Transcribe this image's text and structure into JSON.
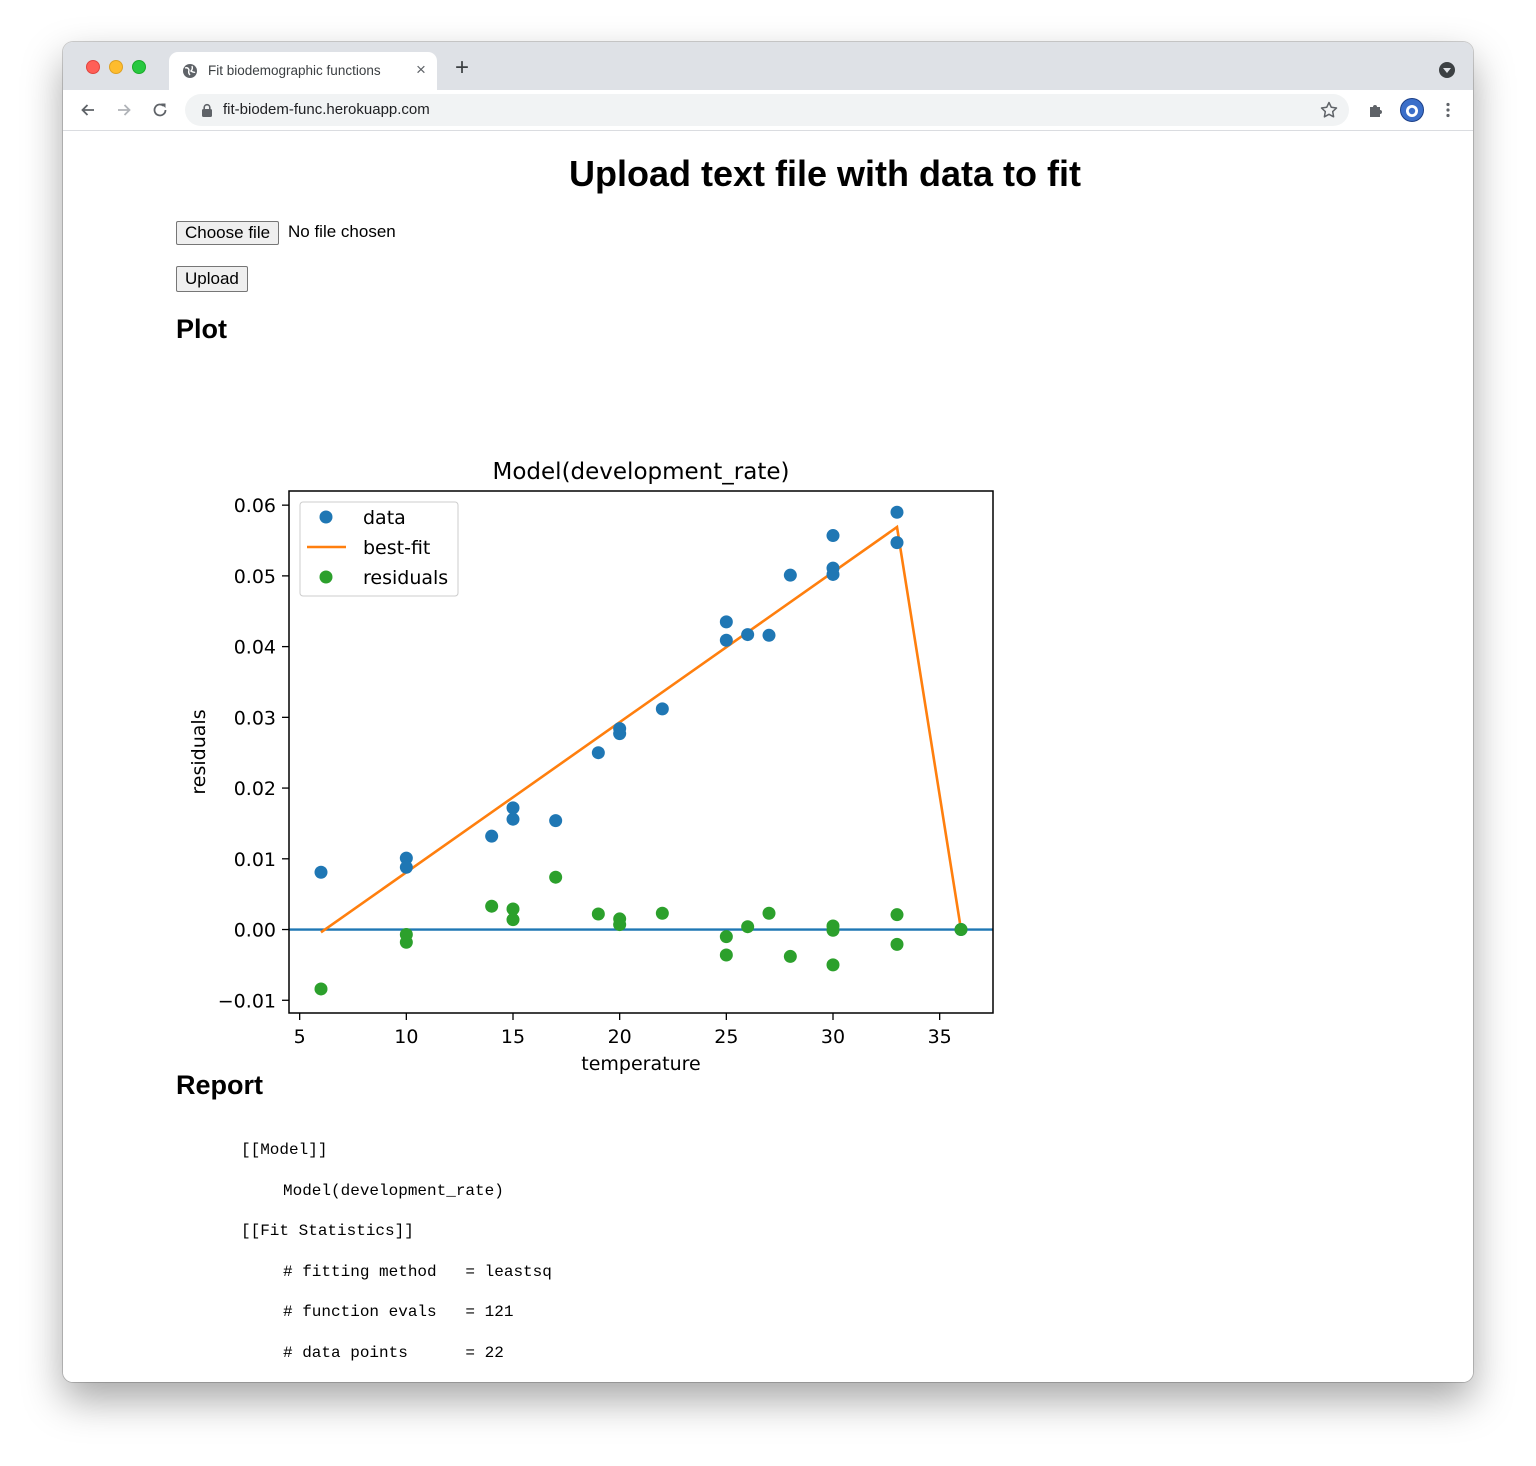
{
  "browser": {
    "tab_title": "Fit biodemographic functions",
    "url": "fit-biodem-func.herokuapp.com",
    "new_tab_label": "+",
    "close_tab_label": "×"
  },
  "page": {
    "heading": "Upload text file with data to fit",
    "choose_file_label": "Choose file",
    "file_status": "No file chosen",
    "upload_label": "Upload",
    "plot_heading": "Plot",
    "report_heading": "Report"
  },
  "chart_data": {
    "type": "scatter",
    "title": "Model(development_rate)",
    "xlabel": "temperature",
    "ylabel": "residuals",
    "xlim": [
      4.5,
      37.5
    ],
    "ylim": [
      -0.0118,
      0.062
    ],
    "xticks": [
      5,
      10,
      15,
      20,
      25,
      30,
      35
    ],
    "xtick_labels": [
      "5",
      "10",
      "15",
      "20",
      "25",
      "30",
      "35"
    ],
    "yticks": [
      -0.01,
      0.0,
      0.01,
      0.02,
      0.03,
      0.04,
      0.05,
      0.06
    ],
    "ytick_labels": [
      "−0.01",
      "0.00",
      "0.01",
      "0.02",
      "0.03",
      "0.04",
      "0.05",
      "0.06"
    ],
    "legend_position": "upper-left",
    "grid": false,
    "colors": {
      "data": "#1f77b4",
      "best_fit": "#ff7f0e",
      "residuals": "#2ca02c",
      "zero_line": "#1f77b4"
    },
    "series": [
      {
        "name": "data",
        "kind": "scatter",
        "x": [
          6,
          10,
          10,
          14,
          15,
          15,
          17,
          19,
          20,
          20,
          22,
          25,
          25,
          26,
          27,
          28,
          30,
          30,
          30,
          33,
          33,
          36
        ],
        "y": [
          0.0081,
          0.0101,
          0.0088,
          0.0132,
          0.0172,
          0.0156,
          0.0154,
          0.025,
          0.0284,
          0.0277,
          0.0312,
          0.0435,
          0.0409,
          0.0417,
          0.0416,
          0.0501,
          0.0557,
          0.0511,
          0.0502,
          0.059,
          0.0547,
          0.0
        ]
      },
      {
        "name": "best-fit",
        "kind": "line",
        "x": [
          6,
          33,
          36
        ],
        "y": [
          -0.0004,
          0.0569,
          0.0
        ]
      },
      {
        "name": "residuals",
        "kind": "scatter",
        "x": [
          6,
          10,
          10,
          14,
          15,
          15,
          17,
          19,
          20,
          20,
          22,
          25,
          25,
          26,
          27,
          28,
          30,
          30,
          30,
          33,
          33,
          36
        ],
        "y": [
          -0.0084,
          -0.0007,
          -0.0018,
          0.0033,
          0.0029,
          0.0014,
          0.0074,
          0.0022,
          0.0015,
          0.0007,
          0.0023,
          -0.001,
          -0.0036,
          0.0004,
          0.0023,
          -0.0038,
          0.0005,
          -0.0001,
          -0.005,
          0.0021,
          -0.0021,
          0.0
        ]
      }
    ]
  },
  "report": {
    "lines": [
      {
        "indent": 0,
        "text": "[[Model]]"
      },
      {
        "indent": 1,
        "text": "Model(development_rate)"
      },
      {
        "indent": 0,
        "text": "[[Fit Statistics]]"
      },
      {
        "indent": 1,
        "text": "# fitting method   = leastsq"
      },
      {
        "indent": 1,
        "text": "# function evals   = 121"
      },
      {
        "indent": 1,
        "text": "# data points      = 22"
      }
    ]
  }
}
